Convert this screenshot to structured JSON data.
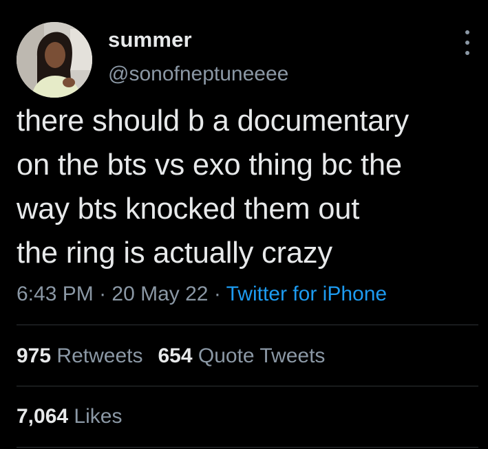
{
  "user": {
    "display_name": "summer",
    "handle": "@sonofneptuneeee",
    "avatar_icon": "profile-photo"
  },
  "tweet": {
    "text": "there should b a documentary\non the bts vs exo thing bc the\nway bts knocked them out\nthe ring is actually crazy",
    "time": "6:43 PM",
    "separator": " · ",
    "date": "20 May 22",
    "source": "Twitter for iPhone"
  },
  "stats": {
    "retweets_count": "975",
    "retweets_label": "Retweets",
    "quotes_count": "654",
    "quotes_label": "Quote Tweets",
    "likes_count": "7,064",
    "likes_label": "Likes"
  },
  "colors": {
    "background": "#000000",
    "text": "#e7e9ea",
    "secondary": "#8b98a5",
    "link": "#1d9bf0",
    "divider": "#2f3336"
  },
  "icons": {
    "more": "more-vertical-icon"
  }
}
